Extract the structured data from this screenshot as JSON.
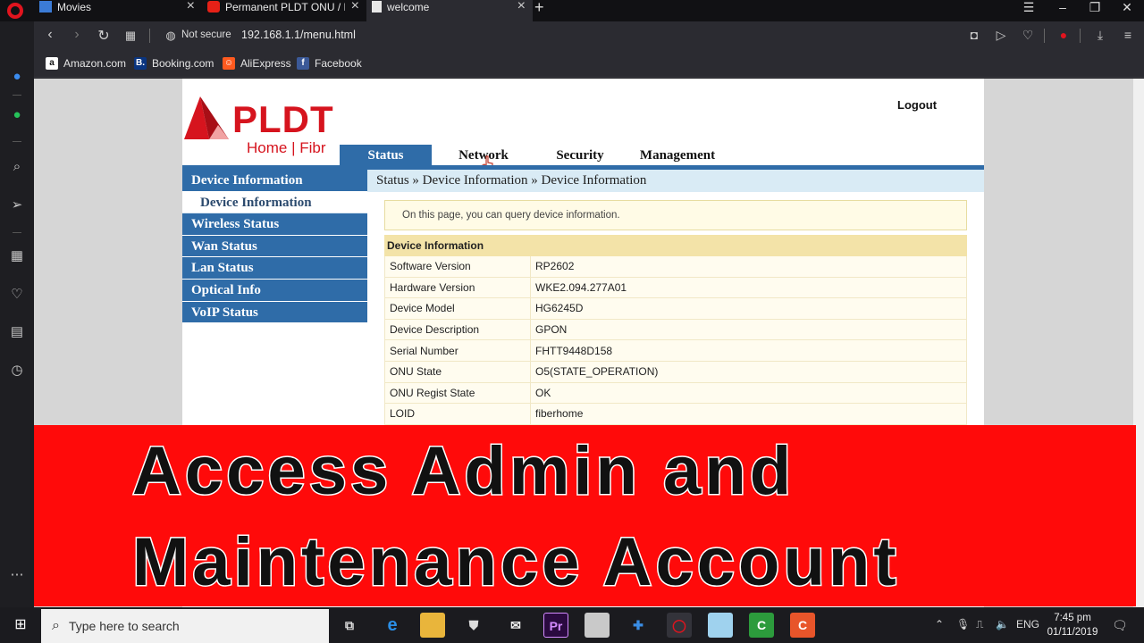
{
  "browser": {
    "tabs": [
      {
        "title": "Movies"
      },
      {
        "title": "Permanent PLDT ONU / Fib"
      },
      {
        "title": "welcome"
      }
    ],
    "not_secure": "Not secure",
    "url": "192.168.1.1/menu.html",
    "bookmarks": [
      {
        "label": "Amazon.com"
      },
      {
        "label": "Booking.com"
      },
      {
        "label": "AliExpress"
      },
      {
        "label": "Facebook"
      }
    ]
  },
  "router": {
    "brand": "PLDT",
    "subbrand": "Home | Fibr",
    "logout": "Logout",
    "top_nav": [
      {
        "label": "Status"
      },
      {
        "label": "Network"
      },
      {
        "label": "Security"
      },
      {
        "label": "Management"
      }
    ],
    "left_menu": [
      {
        "label": "Device Information"
      },
      {
        "label": "Device Information"
      },
      {
        "label": "Wireless Status"
      },
      {
        "label": "Wan Status"
      },
      {
        "label": "Lan Status"
      },
      {
        "label": "Optical Info"
      },
      {
        "label": "VoIP Status"
      }
    ],
    "breadcrumb": "Status » Device Information » Device Information",
    "note": "On this page, you can query device information.",
    "table_title": "Device Information",
    "rows": [
      {
        "key": "Software Version",
        "value": "RP2602"
      },
      {
        "key": "Hardware Version",
        "value": "WKE2.094.277A01"
      },
      {
        "key": "Device Model",
        "value": "HG6245D"
      },
      {
        "key": "Device Description",
        "value": "GPON"
      },
      {
        "key": "Serial Number",
        "value": "FHTT9448D158"
      },
      {
        "key": "ONU State",
        "value": "O5(STATE_OPERATION)"
      },
      {
        "key": "ONU Regist State",
        "value": "OK"
      },
      {
        "key": "LOID",
        "value": "fiberhome"
      }
    ]
  },
  "banner": {
    "line1": "Access Admin and",
    "line2": "Maintenance Account",
    "color": "#ff0a0a"
  },
  "taskbar": {
    "search_placeholder": "Type here to search",
    "lang": "ENG",
    "time": "7:45 pm",
    "date": "01/11/2019"
  },
  "colors": {
    "brand_red": "#d6141e",
    "nav_blue": "#2f6ca8"
  }
}
